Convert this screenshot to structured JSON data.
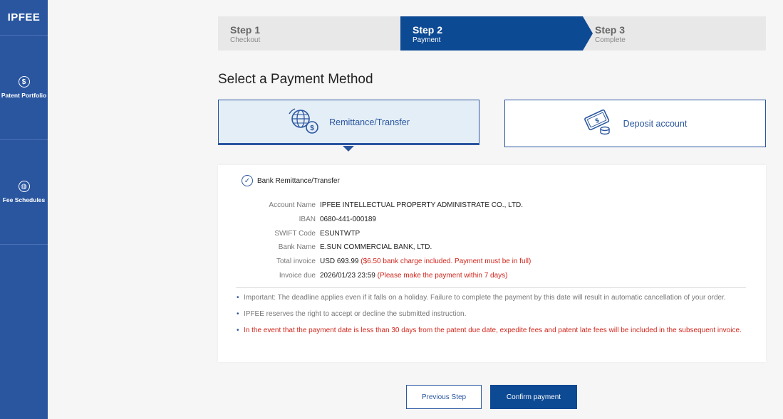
{
  "sidebar": {
    "logo": "IPFEE",
    "items": [
      {
        "label": "Patent Portfolio",
        "icon": "dollar-icon",
        "glyph": "$"
      },
      {
        "label": "Fee Schedules",
        "icon": "globe-icon",
        "glyph": "◍"
      }
    ]
  },
  "steps": [
    {
      "title": "Step 1",
      "subtitle": "Checkout"
    },
    {
      "title": "Step 2",
      "subtitle": "Payment"
    },
    {
      "title": "Step 3",
      "subtitle": "Complete"
    }
  ],
  "heading": "Select a Payment Method",
  "methods": [
    {
      "label": "Remittance/Transfer",
      "icon": "globe-money-icon",
      "selected": true
    },
    {
      "label": "Deposit account",
      "icon": "card-coin-icon",
      "selected": false
    }
  ],
  "panel": {
    "check_label": "Bank Remittance/Transfer",
    "rows": [
      {
        "key": "Account Name",
        "value": "IPFEE INTELLECTUAL PROPERTY ADMINISTRATE CO., LTD.",
        "note": ""
      },
      {
        "key": "IBAN",
        "value": "0680-441-000189",
        "note": ""
      },
      {
        "key": "SWIFT Code",
        "value": "ESUNTWTP",
        "note": ""
      },
      {
        "key": "Bank Name",
        "value": "E.SUN COMMERCIAL BANK, LTD.",
        "note": ""
      },
      {
        "key": "Total invoice",
        "value": "USD 693.99",
        "note": "($6.50 bank charge included. Payment must be in full)"
      },
      {
        "key": "Invoice due",
        "value": "2026/01/23 23:59",
        "note": "(Please make the payment within 7 days)"
      }
    ],
    "notes": [
      "Important: The deadline applies even if it falls on a holiday. Failure to complete the payment by this date will result in automatic cancellation of your order.",
      "IPFEE reserves the right to accept or decline the submitted instruction.",
      "In the event that the payment date is less than 30 days from the patent due date, expedite fees and patent late fees will be included in the subsequent invoice."
    ]
  },
  "buttons": {
    "previous": "Previous Step",
    "confirm": "Confirm payment"
  },
  "colors": {
    "brand": "#2a56a0",
    "active_step": "#0d4a94",
    "warning": "#d0261c"
  }
}
